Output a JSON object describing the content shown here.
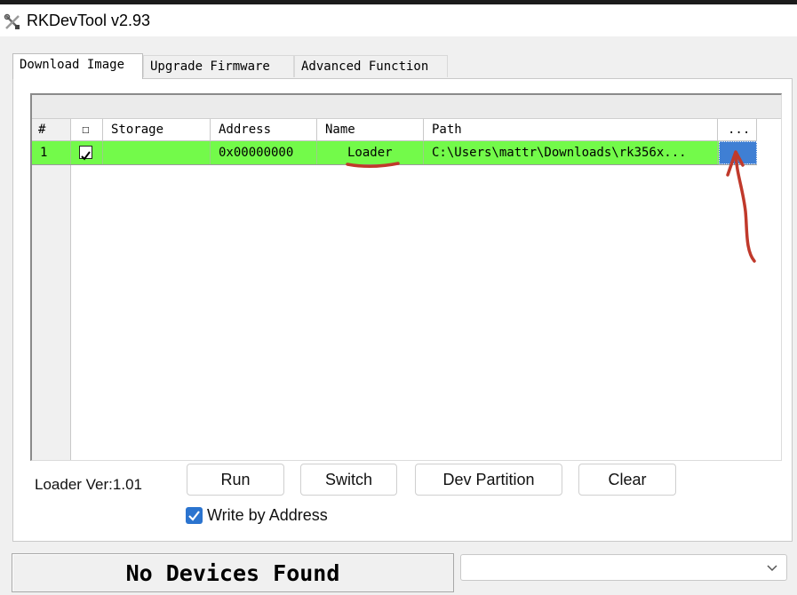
{
  "window": {
    "title": "RKDevTool v2.93"
  },
  "tabs": [
    {
      "label": "Download Image",
      "active": true
    },
    {
      "label": "Upgrade Firmware",
      "active": false
    },
    {
      "label": "Advanced Function",
      "active": false
    }
  ],
  "table": {
    "headers": [
      "#",
      "☐",
      "Storage",
      "Address",
      "Name",
      "Path",
      "..."
    ],
    "rows": [
      {
        "index": "1",
        "checked": true,
        "storage": "",
        "address": "0x00000000",
        "name": "Loader",
        "path": "C:\\Users\\mattr\\Downloads\\rk356x..."
      }
    ],
    "row_color": "#73fa4a",
    "browse_color": "#3f7fd4"
  },
  "loader_version": "Loader Ver:1.01",
  "buttons": {
    "run": "Run",
    "switch": "Switch",
    "dev_partition": "Dev Partition",
    "clear": "Clear"
  },
  "write_by_address": {
    "label": "Write by Address",
    "checked": true
  },
  "status": {
    "text": "No Devices Found"
  },
  "device_combo": {
    "value": ""
  },
  "annotation_color": "#c0392b"
}
